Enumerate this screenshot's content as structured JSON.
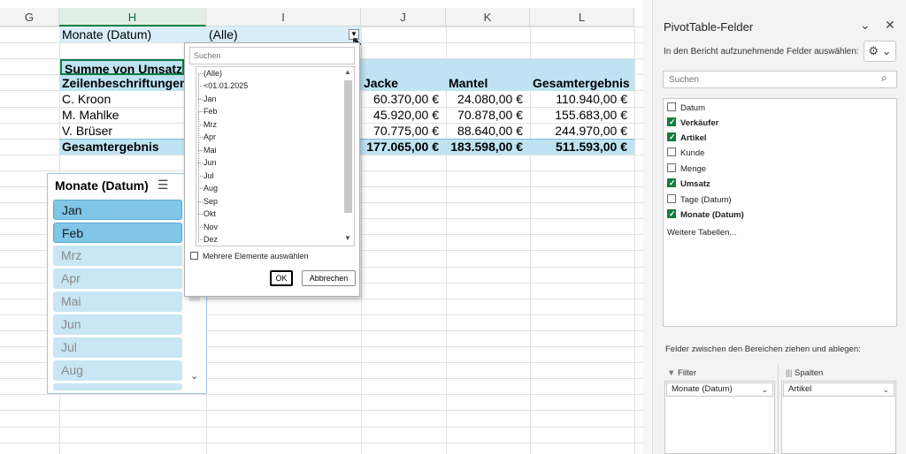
{
  "sheet": {
    "columns": [
      "G",
      "H",
      "I",
      "J",
      "K",
      "L"
    ],
    "selected_column": "H",
    "filter_label": "Monate (Datum)",
    "filter_value": "(Alle)",
    "value_header": "Summe von Umsatz",
    "row_label_header": "Zeilenbeschriftungen",
    "col_headers": [
      "Jacke",
      "Mantel",
      "Gesamtergebnis"
    ],
    "rows": [
      {
        "label": "C. Kroon",
        "values": [
          "60.370,00 €",
          "24.080,00 €",
          "110.940,00 €"
        ]
      },
      {
        "label": "M. Mahlke",
        "values": [
          "45.920,00 €",
          "70.878,00 €",
          "155.683,00 €"
        ]
      },
      {
        "label": "V. Brüser",
        "values": [
          "70.775,00 €",
          "88.640,00 €",
          "244.970,00 €"
        ]
      }
    ],
    "total": {
      "label": "Gesamtergebnis",
      "values": [
        "177.065,00 €",
        "183.598,00 €",
        "511.593,00 €"
      ]
    }
  },
  "slicer": {
    "title": "Monate (Datum)",
    "items": [
      {
        "label": "Jan",
        "selected": true
      },
      {
        "label": "Feb",
        "selected": true
      },
      {
        "label": "Mrz",
        "selected": false
      },
      {
        "label": "Apr",
        "selected": false
      },
      {
        "label": "Mai",
        "selected": false
      },
      {
        "label": "Jun",
        "selected": false
      },
      {
        "label": "Jul",
        "selected": false
      },
      {
        "label": "Aug",
        "selected": false
      }
    ]
  },
  "dropdown": {
    "search_placeholder": "Suchen",
    "items": [
      "(Alle)",
      "<01.01.2025",
      "Jan",
      "Feb",
      "Mrz",
      "Apr",
      "Mai",
      "Jun",
      "Jul",
      "Aug",
      "Sep",
      "Okt",
      "Nov",
      "Dez"
    ],
    "multi_select_label": "Mehrere Elemente auswählen",
    "ok_label": "OK",
    "cancel_label": "Abbrechen"
  },
  "pane": {
    "title": "PivotTable-Felder",
    "subtitle": "In den Bericht aufzunehmende Felder auswählen:",
    "search_placeholder": "Suchen",
    "fields": [
      {
        "label": "Datum",
        "checked": false
      },
      {
        "label": "Verkäufer",
        "checked": true
      },
      {
        "label": "Artikel",
        "checked": true
      },
      {
        "label": "Kunde",
        "checked": false
      },
      {
        "label": "Menge",
        "checked": false
      },
      {
        "label": "Umsatz",
        "checked": true
      },
      {
        "label": "Tage (Datum)",
        "checked": false
      },
      {
        "label": "Monate (Datum)",
        "checked": true
      }
    ],
    "more_tables": "Weitere Tabellen...",
    "areas_label": "Felder zwischen den Bereichen ziehen und ablegen:",
    "filter_zone_label": "Filter",
    "columns_zone_label": "Spalten",
    "filter_zone_item": "Monate (Datum)",
    "columns_zone_item": "Artikel"
  },
  "icons": {
    "slicer_multiselect": "multi-select-icon",
    "filter_dropdown": "filter-dropdown-icon",
    "cursor": "mouse-pointer-icon",
    "gear": "gear-icon",
    "search": "search-icon",
    "close": "close-icon",
    "chevron": "chevron-down-icon",
    "filter_zone": "funnel-icon",
    "columns_zone": "columns-icon"
  },
  "colors": {
    "accent_green": "#107c41",
    "pivot_header_blue": "#bfe3f3",
    "slicer_selected": "#7fc6e8",
    "slicer_unselected": "#c8e6f4"
  }
}
